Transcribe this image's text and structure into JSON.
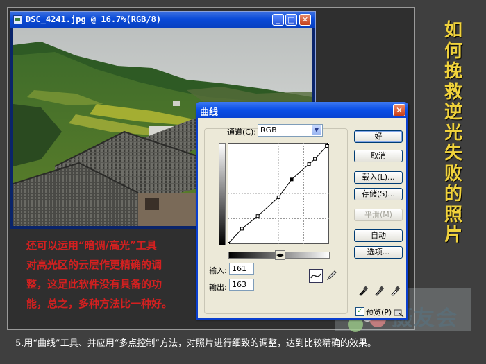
{
  "photo_window": {
    "title": "DSC_4241.jpg @ 16.7%(RGB/8)",
    "buttons": {
      "minimize": "_",
      "maximize": "□",
      "close": "✕"
    }
  },
  "side_title": [
    "如",
    "何",
    "挽",
    "救",
    "逆",
    "光",
    "失",
    "败",
    "的",
    "照",
    "片"
  ],
  "red_text": [
    "还可以运用“暗调/高光”工具",
    "对高光区的云层作更精确的调",
    "整，这是此软件没有具备的功",
    "能，总之，多种方法比一种好。"
  ],
  "dialog": {
    "title": "曲线",
    "channel_label": "通道(C):",
    "channel_value": "RGB",
    "input_label": "输入:",
    "input_value": "161",
    "output_label": "输出:",
    "output_value": "163",
    "buttons": {
      "ok": "好",
      "cancel": "取消",
      "load": "载入(L)...",
      "save": "存储(S)...",
      "smooth": "平滑(M)",
      "auto": "自动",
      "options": "选项..."
    },
    "preview_label": "预览(P)",
    "preview_checked": true
  },
  "curve": {
    "points": [
      [
        0,
        0
      ],
      [
        35,
        38
      ],
      [
        75,
        70
      ],
      [
        128,
        118
      ],
      [
        161,
        163
      ],
      [
        205,
        202
      ],
      [
        220,
        215
      ],
      [
        250,
        248
      ],
      [
        255,
        255
      ]
    ]
  },
  "watermark": "摄友会",
  "caption": "5.用“曲线”工具、并应用“多点控制”方法，对照片进行细致的调整，达到比较精确的效果。",
  "colors": {
    "background": "#3f3f3f",
    "title_yellow": "#f0d23c",
    "red_text": "#d42020",
    "xp_blue": "#0a4ee6"
  }
}
